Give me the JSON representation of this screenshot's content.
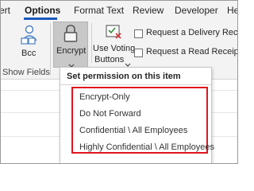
{
  "tabs": [
    {
      "label": "ert"
    },
    {
      "label": "Options"
    },
    {
      "label": "Format Text"
    },
    {
      "label": "Review"
    },
    {
      "label": "Developer"
    },
    {
      "label": "He"
    }
  ],
  "ribbon": {
    "bcc_label": "Bcc",
    "show_fields_label": "Show Fields",
    "encrypt_label": "Encrypt",
    "voting_line1": "Use Voting",
    "voting_line2": "Buttons",
    "delivery_receipt_label": "Request a Delivery Receipt",
    "read_receipt_label": "Request a Read Receipt"
  },
  "dropdown": {
    "header": "Set permission on this item",
    "items": [
      {
        "label": "Encrypt-Only"
      },
      {
        "label": "Do Not Forward"
      },
      {
        "label": "Confidential \\ All Employees"
      },
      {
        "label": "Highly Confidential \\ All Employees"
      }
    ]
  },
  "colors": {
    "accent": "#185abd",
    "highlight": "#e0151f"
  }
}
